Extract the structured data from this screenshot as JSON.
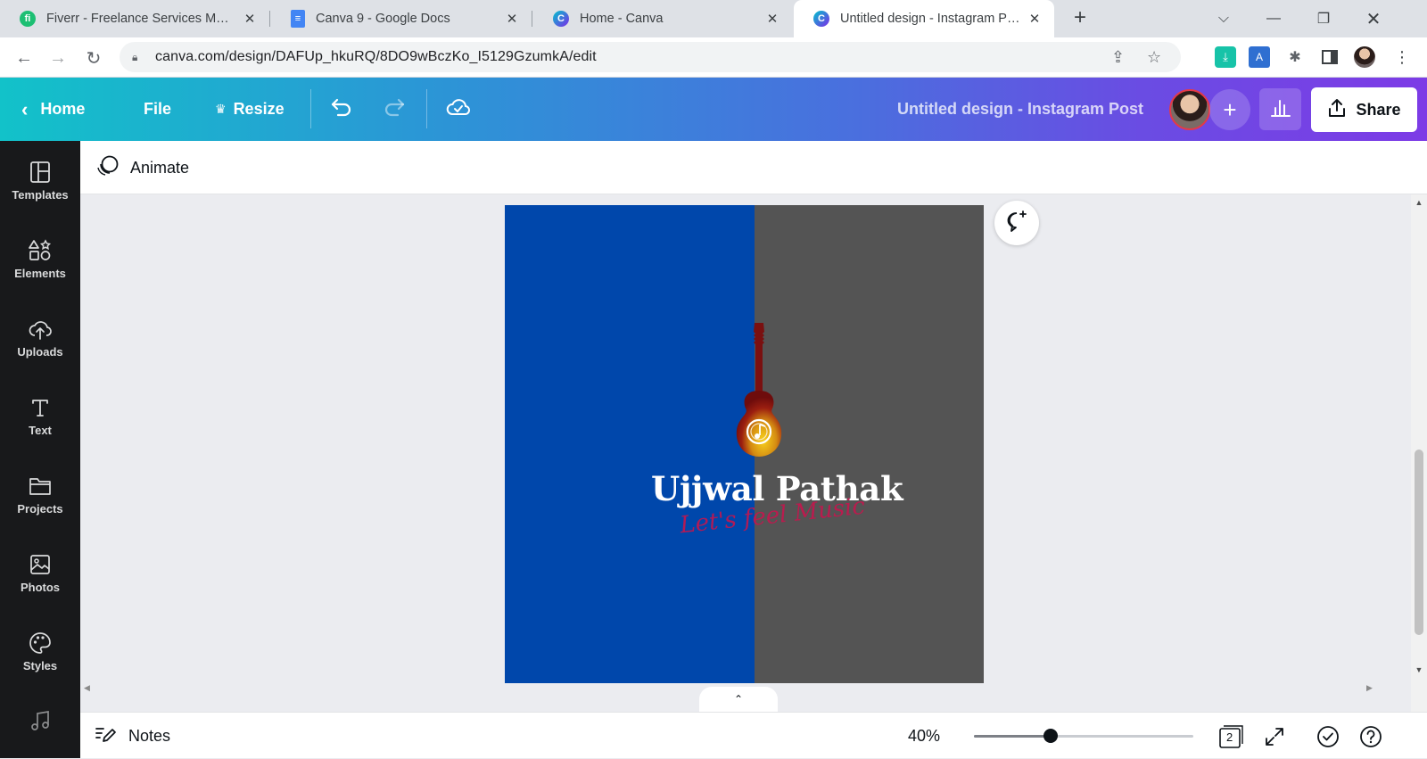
{
  "browser": {
    "tabs": [
      {
        "title": "Fiverr - Freelance Services Marketplace",
        "favicon": "fiverr-icon",
        "color": "#1dbf73",
        "active": false
      },
      {
        "title": "Canva 9 - Google Docs",
        "favicon": "google-docs-icon",
        "color": "#4285f4",
        "active": false
      },
      {
        "title": "Home - Canva",
        "favicon": "canva-icon",
        "color": "#00c4cc",
        "active": false
      },
      {
        "title": "Untitled design - Instagram Post",
        "favicon": "canva-icon",
        "color": "#00c4cc",
        "active": true
      }
    ],
    "url": "canva.com/design/DAFUp_hkuRQ/8DO9wBczKo_I5129GzumkA/edit"
  },
  "header": {
    "home_label": "Home",
    "file_label": "File",
    "resize_label": "Resize",
    "doc_title": "Untitled design - Instagram Post",
    "share_label": "Share"
  },
  "sidebar": {
    "items": [
      {
        "label": "Templates",
        "icon": "templates-icon"
      },
      {
        "label": "Elements",
        "icon": "elements-icon"
      },
      {
        "label": "Uploads",
        "icon": "uploads-icon"
      },
      {
        "label": "Text",
        "icon": "text-icon"
      },
      {
        "label": "Projects",
        "icon": "projects-icon"
      },
      {
        "label": "Photos",
        "icon": "photos-icon"
      },
      {
        "label": "Styles",
        "icon": "styles-icon"
      },
      {
        "label": "",
        "icon": "music-icon"
      }
    ]
  },
  "toolbar": {
    "animate_label": "Animate"
  },
  "design": {
    "brand_name": "Ujjwal Pathak",
    "tagline": "Let's feel Music",
    "left_color": "#0047ab",
    "right_color": "#545454"
  },
  "footer": {
    "notes_label": "Notes",
    "zoom": "40%",
    "zoom_fraction": 0.35,
    "page_count": "2"
  }
}
